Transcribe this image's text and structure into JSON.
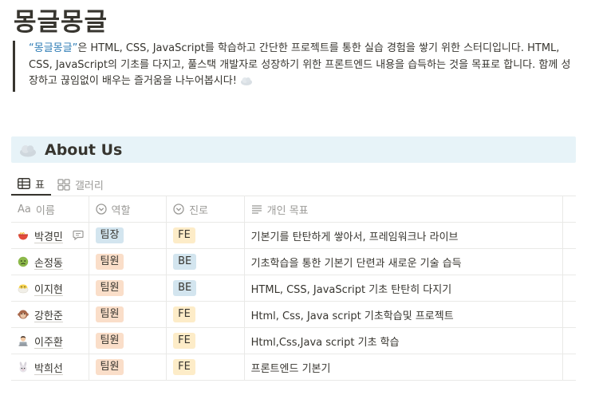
{
  "page": {
    "title": "몽글몽글"
  },
  "intro": {
    "highlight": "“몽글몽글”",
    "text": "은 HTML, CSS, JavaScript를 학습하고 간단한 프로젝트를 통한 실습 경험을 쌓기 위한 스터디입니다. HTML, CSS, JavaScript의 기초를 다지고, 풀스택 개발자로 성장하기 위한 프론트엔드 내용을 습득하는 것을 목표로 합니다. 함께 성장하고 끊임없이 배우는 즐거움을 나누어봅시다!",
    "emoji_icon": "cloud-icon"
  },
  "callout": {
    "heading": "About Us",
    "icon": "cloud-icon",
    "background": "#e7f3f8"
  },
  "views": [
    {
      "label": "표",
      "icon": "table-icon",
      "active": true
    },
    {
      "label": "갤러리",
      "icon": "gallery-icon",
      "active": false
    }
  ],
  "table": {
    "columns": [
      {
        "label": "이름",
        "icon": "Aa"
      },
      {
        "label": "역할",
        "icon": "select-icon"
      },
      {
        "label": "진로",
        "icon": "select-icon"
      },
      {
        "label": "개인 목표",
        "icon": "text-lines-icon"
      }
    ],
    "rows": [
      {
        "name": "박경민",
        "emoji": "ramen-icon",
        "has_comment": true,
        "role": "팀장",
        "role_color": "blue",
        "path": "FE",
        "path_color": "yellow",
        "goal": "기본기를 탄탄하게 쌓아서, 프레임워크나 라이브"
      },
      {
        "name": "손정동",
        "emoji": "sick-face-icon",
        "has_comment": false,
        "role": "팀원",
        "role_color": "orange",
        "path": "BE",
        "path_color": "blue",
        "goal": "기초학습을 통한 기본기 단련과 새로운 기술 습득"
      },
      {
        "name": "이지현",
        "emoji": "chick-icon",
        "has_comment": false,
        "role": "팀원",
        "role_color": "orange",
        "path": "BE",
        "path_color": "blue",
        "goal": "HTML, CSS, JavaScript 기초 탄탄히 다지기"
      },
      {
        "name": "강한준",
        "emoji": "monkey-icon",
        "has_comment": false,
        "role": "팀원",
        "role_color": "orange",
        "path": "FE",
        "path_color": "yellow",
        "goal": "Html, Css, Java script 기초학습및 프로젝트"
      },
      {
        "name": "이주환",
        "emoji": "person-laptop-icon",
        "has_comment": false,
        "role": "팀원",
        "role_color": "orange",
        "path": "FE",
        "path_color": "yellow",
        "goal": "Html,Css,Java script 기초 학습"
      },
      {
        "name": "박희선",
        "emoji": "rabbit-icon",
        "has_comment": false,
        "role": "팀원",
        "role_color": "orange",
        "path": "FE",
        "path_color": "yellow",
        "goal": "프론트엔드 기본기"
      }
    ]
  },
  "colors": {
    "text": "#37352f",
    "muted": "#9b9a97",
    "link": "#2e7cb5",
    "tag_blue": "#d3e5ef",
    "tag_orange": "#fadec9",
    "tag_yellow": "#fdecc8"
  }
}
